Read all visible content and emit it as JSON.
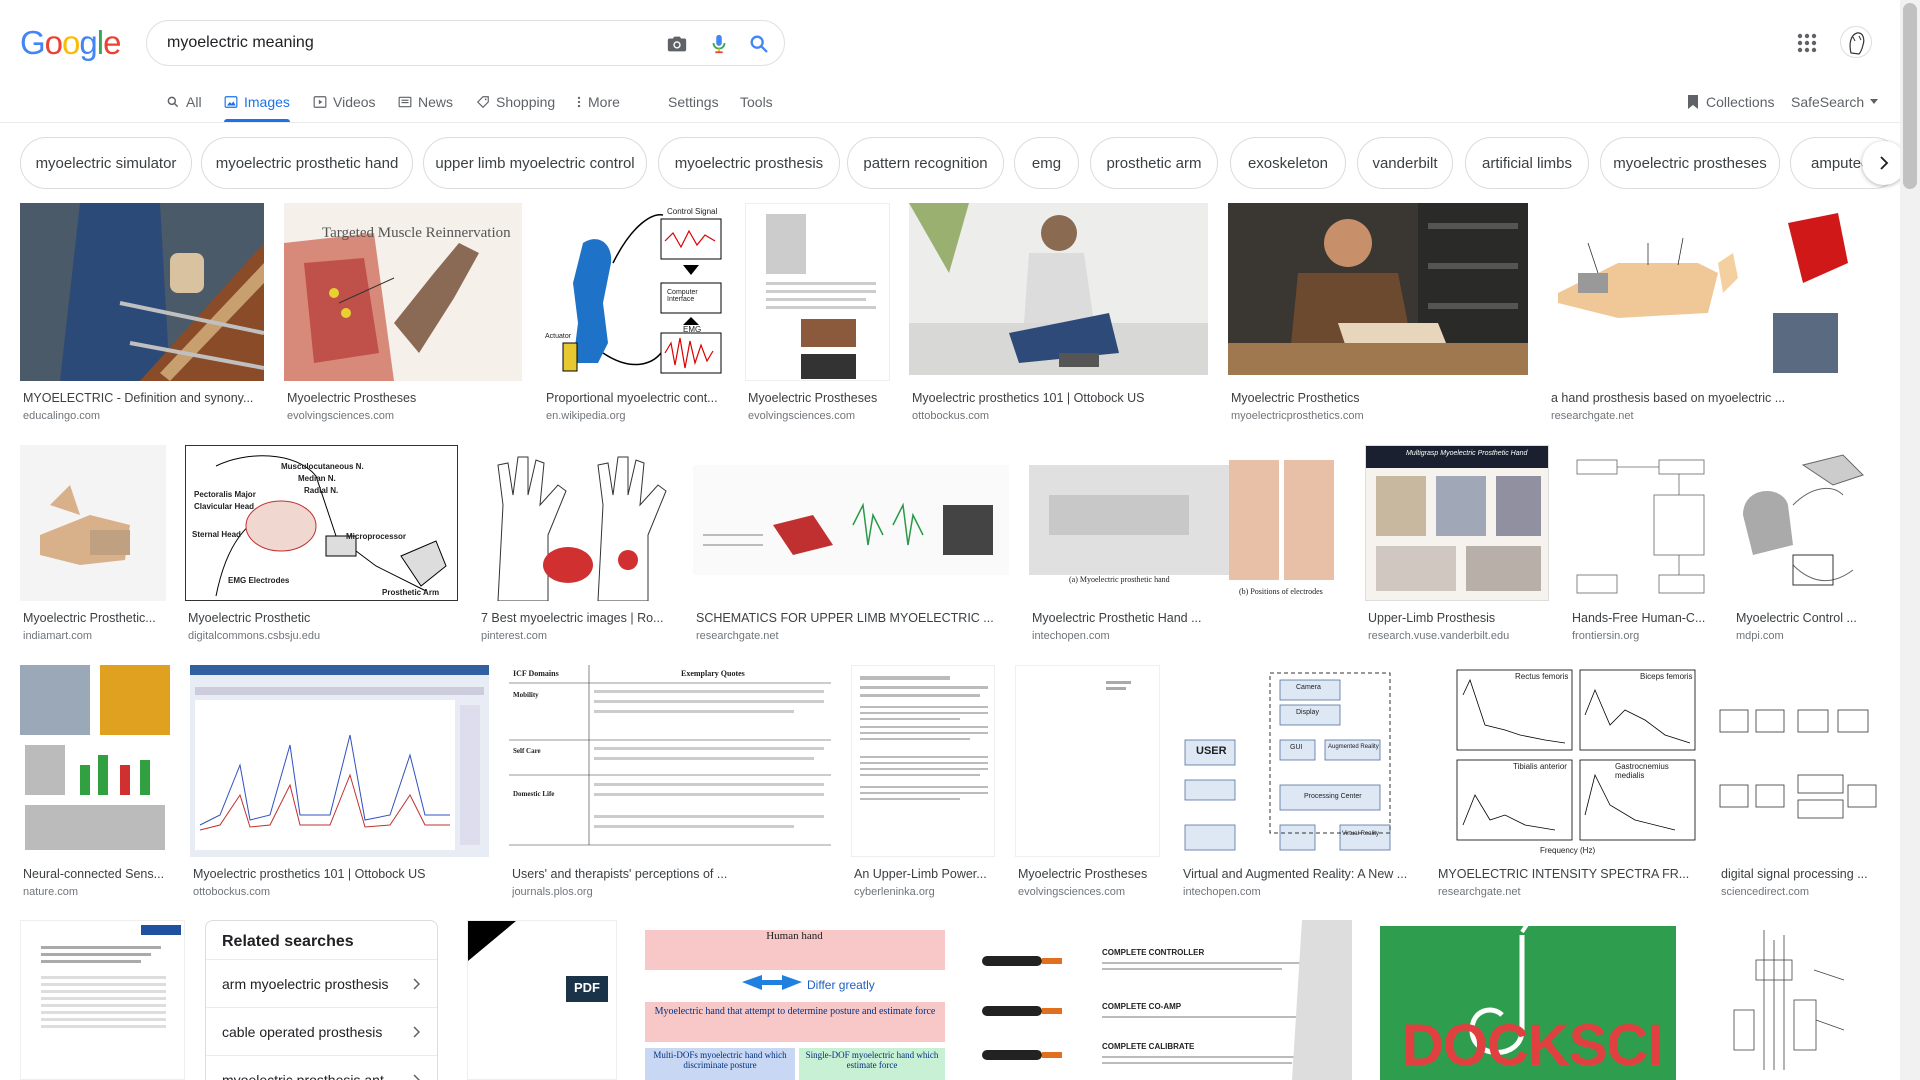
{
  "logo": {
    "text": "Google"
  },
  "search": {
    "query": "myoelectric meaning"
  },
  "tabs": [
    {
      "label": "All",
      "icon": "search-icon"
    },
    {
      "label": "Images",
      "icon": "image-icon"
    },
    {
      "label": "Videos",
      "icon": "video-icon"
    },
    {
      "label": "News",
      "icon": "news-icon"
    },
    {
      "label": "Shopping",
      "icon": "tag-icon"
    },
    {
      "label": "More",
      "icon": "more-vert-icon"
    },
    {
      "label": "Settings"
    },
    {
      "label": "Tools"
    }
  ],
  "header_right": {
    "collections": "Collections",
    "safesearch": "SafeSearch"
  },
  "chips": [
    "myoelectric simulator",
    "myoelectric prosthetic hand",
    "upper limb myoelectric control",
    "myoelectric prosthesis",
    "pattern recognition",
    "emg",
    "prosthetic arm",
    "exoskeleton",
    "vanderbilt",
    "artificial limbs",
    "myoelectric prostheses",
    "amputee"
  ],
  "results": [
    {
      "title": "MYOELECTRIC - Definition and synony...",
      "source": "educalingo.com"
    },
    {
      "title": "Myoelectric Prostheses",
      "source": "evolvingsciences.com",
      "thumb_text": "Targeted Muscle Reinnervation"
    },
    {
      "title": "Proportional myoelectric cont...",
      "source": "en.wikipedia.org",
      "thumb_labels": [
        "Control Signal",
        "Computer Interface",
        "EMG",
        "Actuator"
      ]
    },
    {
      "title": "Myoelectric Prostheses",
      "source": "evolvingsciences.com"
    },
    {
      "title": "Myoelectric prosthetics 101 | Ottobock US",
      "source": "ottobockus.com"
    },
    {
      "title": "Myoelectric Prosthetics",
      "source": "myoelectricprosthetics.com"
    },
    {
      "title": "a hand prosthesis based on myoelectric ...",
      "source": "researchgate.net"
    },
    {
      "title": "Myoelectric Prosthetic...",
      "source": "indiamart.com"
    },
    {
      "title": "Myoelectric Prosthetic",
      "source": "digitalcommons.csbsju.edu",
      "thumb_labels": [
        "Musculocutaneous N.",
        "Median N.",
        "Radial N.",
        "Pectoralis Major",
        "Clavicular Head",
        "Sternal Head",
        "Microprocessor",
        "EMG Electrodes",
        "Prosthetic Arm"
      ]
    },
    {
      "title": "7 Best myoelectric images | Ro...",
      "source": "pinterest.com"
    },
    {
      "title": "SCHEMATICS FOR UPPER LIMB MYOELECTRIC ...",
      "source": "researchgate.net"
    },
    {
      "title": "Myoelectric Prosthetic Hand ...",
      "source": "intechopen.com",
      "thumb_labels": [
        "(a) Myoelectric prosthetic hand",
        "(b) Positions of electrodes"
      ]
    },
    {
      "title": "Upper-Limb Prosthesis",
      "source": "research.vuse.vanderbilt.edu",
      "thumb_text": "Multigrasp Myoelectric Prosthetic Hand"
    },
    {
      "title": "Hands-Free Human-C...",
      "source": "frontiersin.org"
    },
    {
      "title": "Myoelectric Control ...",
      "source": "mdpi.com"
    },
    {
      "title": "Neural-connected Sens...",
      "source": "nature.com"
    },
    {
      "title": "Myoelectric prosthetics 101 | Ottobock US",
      "source": "ottobockus.com"
    },
    {
      "title": "Users' and therapists' perceptions of ...",
      "source": "journals.plos.org",
      "thumb_labels": [
        "ICF Domains",
        "Exemplary Quotes",
        "Mobility",
        "Self Care",
        "Domestic Life"
      ]
    },
    {
      "title": "An Upper-Limb Power...",
      "source": "cyberleninka.org"
    },
    {
      "title": "Myoelectric Prostheses",
      "source": "evolvingsciences.com"
    },
    {
      "title": "Virtual and Augmented Reality: A New ...",
      "source": "intechopen.com",
      "thumb_labels": [
        "USER",
        "Camera",
        "Display",
        "GUI",
        "Augmented Reality",
        "Processing Center",
        "Virtual Reality"
      ]
    },
    {
      "title": "MYOELECTRIC INTENSITY SPECTRA FR...",
      "source": "researchgate.net",
      "thumb_labels": [
        "Rectus femoris",
        "Biceps femoris",
        "Tibialis anterior",
        "Gastrocnemius medialis",
        "Frequency (Hz)"
      ]
    },
    {
      "title": "digital signal processing ...",
      "source": "sciencedirect.com"
    }
  ],
  "related": {
    "title": "Related searches",
    "items": [
      "arm myoelectric prosthesis",
      "cable operated prosthesis",
      "myoelectric prosthesis ant"
    ]
  },
  "bottom_thumbs": {
    "pdf_badge": "PDF",
    "human_hand": [
      "Human hand",
      "Differ greatly",
      "Myoelectric hand that attempt to determine posture and estimate force",
      "Multi-DOFs myoelectric hand which discriminate posture",
      "Single-DOF myoelectric hand which estimate force"
    ],
    "controller": [
      "COMPLETE CONTROLLER",
      "COMPLETE CO-AMP",
      "COMPLETE CALIBRATE"
    ],
    "docksci": "DOCKSCI"
  },
  "colors": {
    "accent": "#1a73e8",
    "chip_border": "#dadce0",
    "docksci_green": "#2e9e4e"
  }
}
